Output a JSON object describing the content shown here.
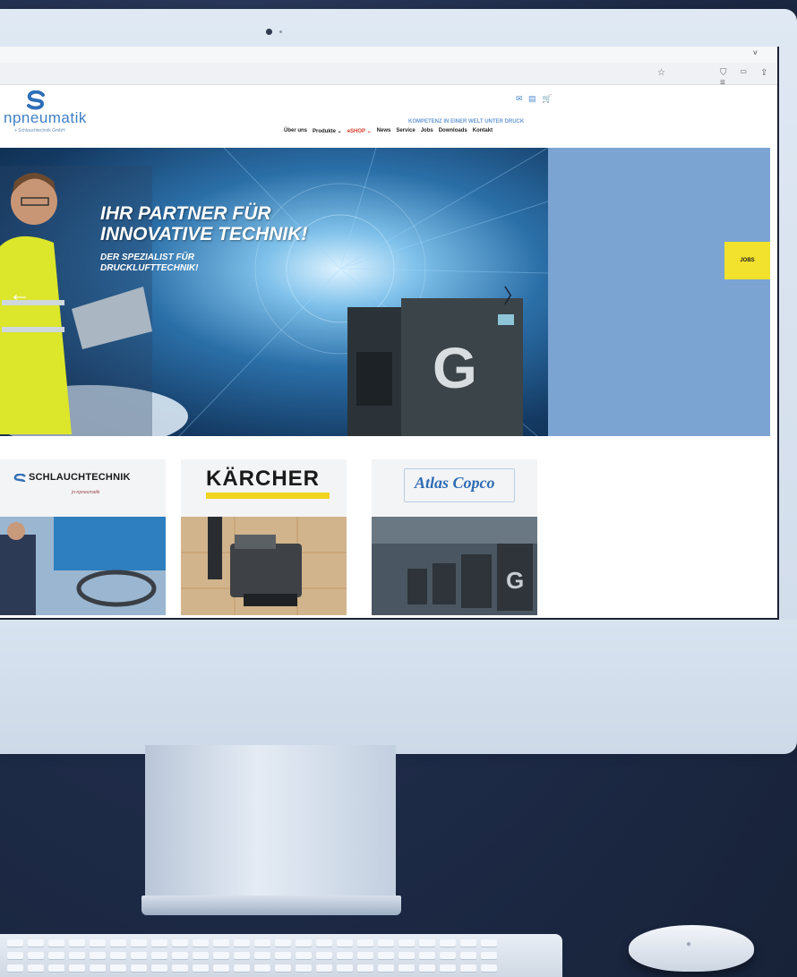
{
  "site": {
    "logo_text": "npneumatik",
    "logo_sub": "+ Schlauchtechnik GmbH",
    "tagline": "KOMPETENZ IN EINER WELT UNTER DRUCK",
    "nav": {
      "ueber": "Über uns",
      "produkte": "Produkte ⌄",
      "eshop": "eSHOP ⌄",
      "news": "News",
      "service": "Service",
      "jobs": "Jobs",
      "downloads": "Downloads",
      "kontakt": "Kontakt"
    },
    "header_icons": "✉ ▤ 🛒"
  },
  "hero": {
    "title_line1": "IHR PARTNER FÜR",
    "title_line2": "INNOVATIVE TECHNIK!",
    "sub_line1": "DER SPEZIALIST FÜR",
    "sub_line2": "DRUCKLUFTTECHNIK!",
    "prev_arrow": "←",
    "next_arrow": "〉"
  },
  "jobs_tab": "JOBS",
  "cards": {
    "schlauch": {
      "title": "SCHLAUCHTECHNIK",
      "subtitle": "jn-npneumatik"
    },
    "kaercher": {
      "title": "KÄRCHER"
    },
    "atlas": {
      "title": "Atlas Copco"
    }
  },
  "browser": {
    "bookmark_icon": "star-icon",
    "tab_chevron": "˅",
    "toolbar_icons": "⛉ ▭ ⇪ ≡"
  },
  "colors": {
    "accent_blue": "#3f7fc4",
    "eshop_red": "#d43a2a",
    "jobs_yellow": "#f2e12d",
    "kaercher_yellow": "#f0d420",
    "background_navy": "#1e2b48"
  }
}
